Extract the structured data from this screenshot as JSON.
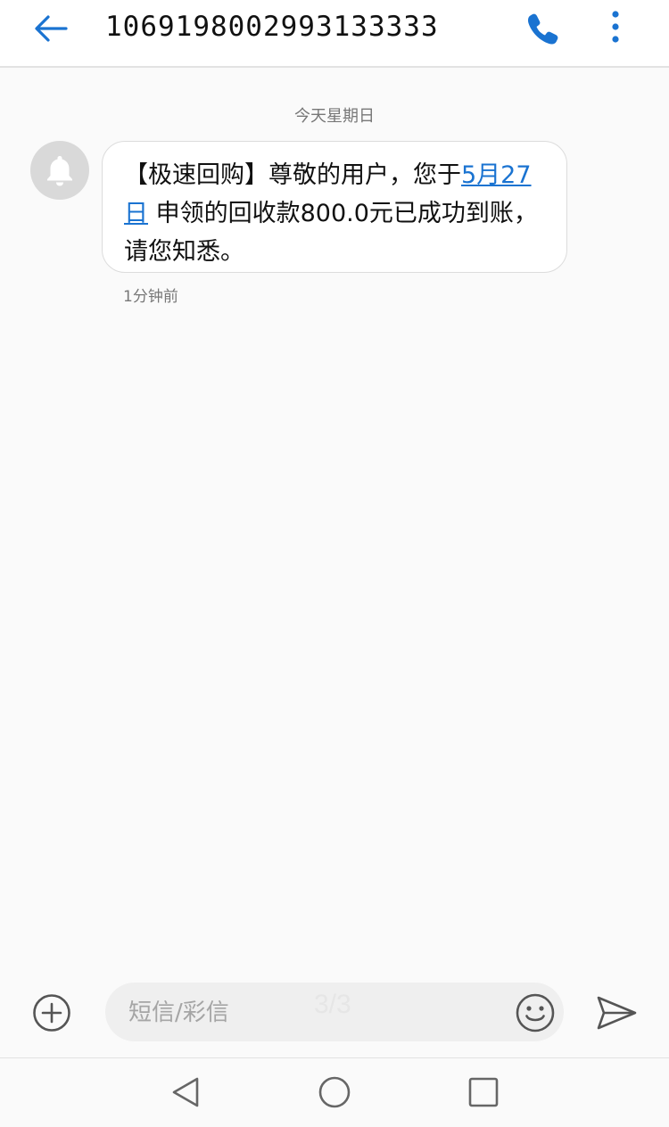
{
  "header": {
    "title": "1069198002993133333",
    "back_icon": "arrow-left-icon",
    "call_icon": "phone-icon",
    "more_icon": "more-vertical-icon",
    "accent_color": "#1a73d1"
  },
  "conversation": {
    "date_separator": "今天星期日",
    "avatar_icon": "bell-icon",
    "message": {
      "text_before": "【极速回购】尊敬的用户，您于",
      "link_text": "5月27日",
      "text_after": "申领的回收款800.0元已成功到账，请您知悉。",
      "time": "1分钟前"
    }
  },
  "composer": {
    "add_icon": "plus-circle-icon",
    "placeholder": "短信/彩信",
    "counter": "3/3",
    "emoji_icon": "smiley-icon",
    "send_icon": "send-icon"
  },
  "navbar": {
    "back_icon": "nav-back-triangle-icon",
    "home_icon": "nav-home-circle-icon",
    "recent_icon": "nav-recent-square-icon"
  }
}
